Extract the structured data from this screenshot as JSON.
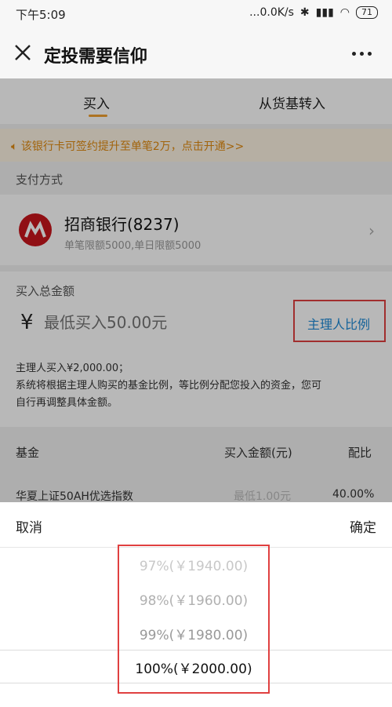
{
  "status": {
    "time": "下午5:09",
    "network": "...0.0K/s",
    "battery": "71"
  },
  "header": {
    "title": "定投需要信仰"
  },
  "tabs": [
    {
      "label": "买入"
    },
    {
      "label": "从货基转入"
    }
  ],
  "notice": "该银行卡可签约提升至单笔2万，点击开通>>",
  "payment": {
    "section_label": "支付方式",
    "bank_name": "招商银行(8237)",
    "bank_limit": "单笔限额5000,单日限额5000"
  },
  "purchase": {
    "section_label": "买入总金额",
    "currency": "¥",
    "placeholder": "最低买入50.00元",
    "ratio_button": "主理人比例",
    "info_line1": "主理人买入¥2,000.00；",
    "info_line2": "系统将根据主理人购买的基金比例，等比例分配您投入的资金，您可",
    "info_line3": "自行再调整具体金额。"
  },
  "fund_table": {
    "headers": [
      "基金",
      "买入金额(元)",
      "配比"
    ],
    "rows": [
      {
        "name": "华夏上证50AH优选指数",
        "amount_placeholder": "最低1.00元",
        "ratio": "40.00%"
      }
    ]
  },
  "picker": {
    "cancel": "取消",
    "confirm": "确定",
    "options": [
      "97%(￥1940.00)",
      "98%(￥1960.00)",
      "99%(￥1980.00)",
      "100%(￥2000.00)"
    ],
    "selected_index": 3
  },
  "colors": {
    "accent_orange": "#f0a030",
    "link_blue": "#1e8ad6",
    "highlight_red": "#e04040",
    "bank_red": "#c8161d"
  }
}
